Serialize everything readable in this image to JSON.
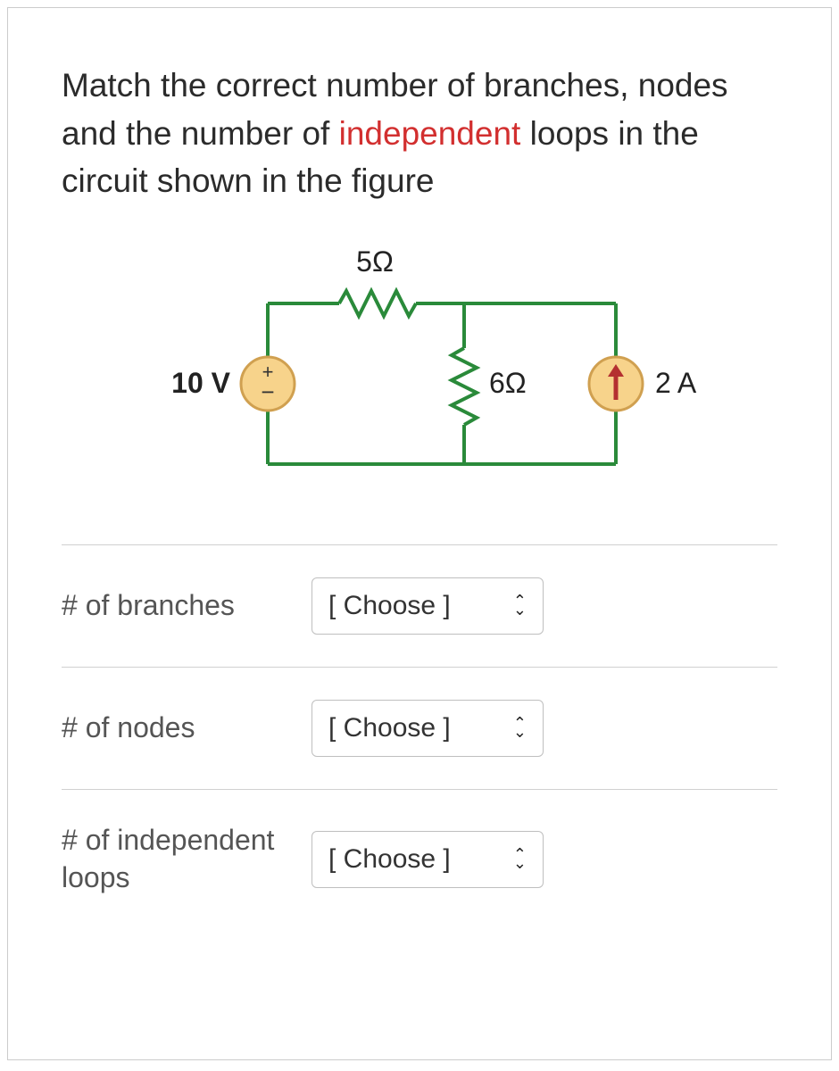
{
  "question": {
    "pre": "Match the correct number of branches, nodes and the number of ",
    "red": "independent",
    "post": " loops in the circuit shown in the figure"
  },
  "circuit": {
    "r_top": "5Ω",
    "v_src": "10 V",
    "r_mid": "6Ω",
    "i_src": "2 A"
  },
  "rows": [
    {
      "label": "# of branches",
      "selected": "[ Choose ]"
    },
    {
      "label": "# of nodes",
      "selected": "[ Choose ]"
    },
    {
      "label": "# of independent loops",
      "selected": "[ Choose ]"
    }
  ]
}
